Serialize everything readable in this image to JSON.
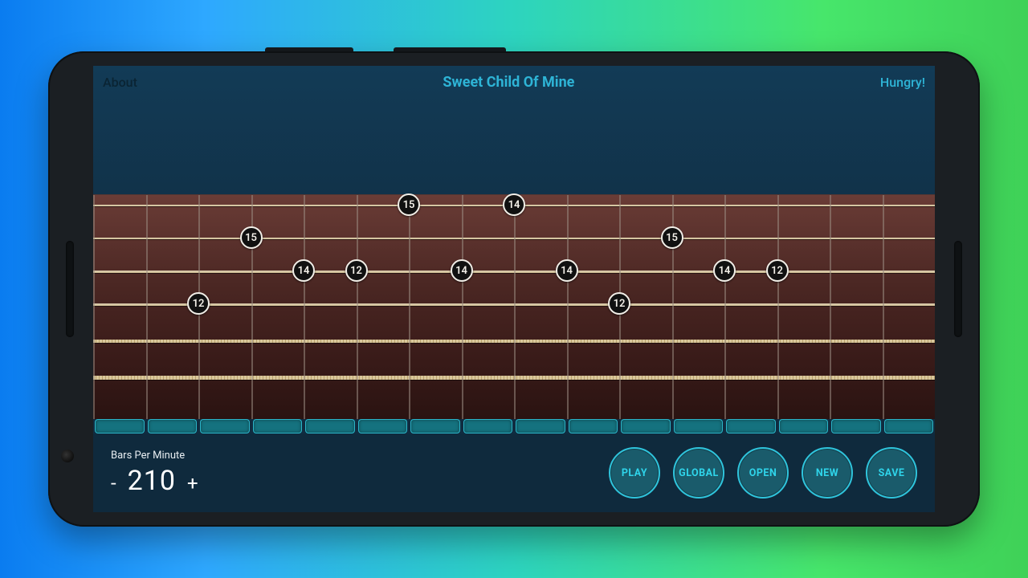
{
  "topbar": {
    "about": "About",
    "title": "Sweet Child Of Mine",
    "hungry": "Hungry!"
  },
  "bpm": {
    "label": "Bars Per Minute",
    "minus": "-",
    "value": "210",
    "plus": "+"
  },
  "actions": {
    "play": "PLAY",
    "global": "GLOBAL",
    "open": "OPEN",
    "new": "NEW",
    "save": "SAVE"
  },
  "board": {
    "columns": 16,
    "beats": 16,
    "notes": [
      {
        "col": 2,
        "string": 4,
        "fret": "12"
      },
      {
        "col": 3,
        "string": 2,
        "fret": "15"
      },
      {
        "col": 4,
        "string": 3,
        "fret": "14"
      },
      {
        "col": 5,
        "string": 3,
        "fret": "12"
      },
      {
        "col": 6,
        "string": 1,
        "fret": "15"
      },
      {
        "col": 7,
        "string": 3,
        "fret": "14"
      },
      {
        "col": 8,
        "string": 1,
        "fret": "14"
      },
      {
        "col": 9,
        "string": 3,
        "fret": "14"
      },
      {
        "col": 10,
        "string": 4,
        "fret": "12"
      },
      {
        "col": 11,
        "string": 2,
        "fret": "15"
      },
      {
        "col": 12,
        "string": 3,
        "fret": "14"
      },
      {
        "col": 13,
        "string": 3,
        "fret": "12"
      }
    ]
  }
}
